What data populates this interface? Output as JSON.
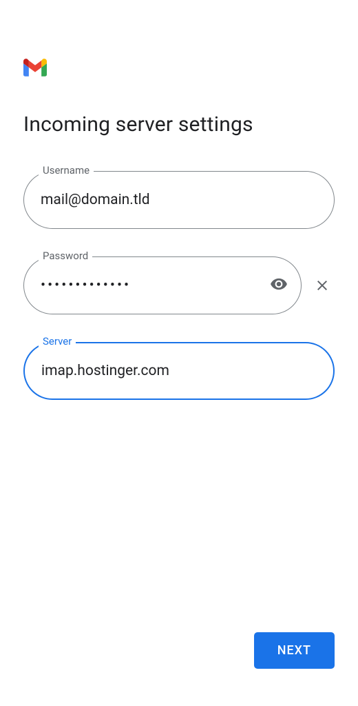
{
  "header": {
    "title": "Incoming server settings"
  },
  "fields": {
    "username": {
      "label": "Username",
      "value": "mail@domain.tld"
    },
    "password": {
      "label": "Password",
      "value": "•••••••••••••"
    },
    "server": {
      "label": "Server",
      "value": "imap.hostinger.com"
    }
  },
  "buttons": {
    "next": "NEXT"
  },
  "colors": {
    "accent": "#1a73e8",
    "text": "#202124",
    "border": "#80868b",
    "muted": "#5f6368"
  }
}
